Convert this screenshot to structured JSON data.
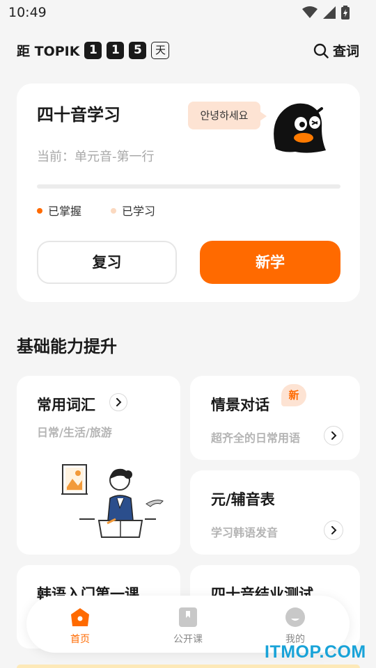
{
  "status_bar": {
    "time": "10:49"
  },
  "header": {
    "countdown_prefix": "距 TOPIK",
    "digits": [
      "1",
      "1",
      "5"
    ],
    "day_label": "天",
    "lookup_label": "查词"
  },
  "main_card": {
    "title": "四十音学习",
    "bubble_text": "안녕하세요",
    "current_label": "当前：单元音-第一行",
    "legend": {
      "mastered": "已掌握",
      "learned": "已学习"
    },
    "progress": {
      "mastered": 0,
      "learned": 0
    },
    "review_button": "复习",
    "new_button": "新学"
  },
  "section": {
    "title": "基础能力提升",
    "tiles": [
      {
        "title": "常用词汇",
        "subtitle": "日常/生活/旅游"
      },
      {
        "title": "情景对话",
        "subtitle": "超齐全的日常用语",
        "badge": "新"
      },
      {
        "title": "元/辅音表",
        "subtitle": "学习韩语发音"
      },
      {
        "title": "韩语入门第一课",
        "subtitle": ""
      },
      {
        "title": "四十音结业测试",
        "subtitle": ""
      }
    ]
  },
  "bottom_nav": {
    "items": [
      {
        "label": "首页",
        "active": true
      },
      {
        "label": "公开课",
        "active": false
      },
      {
        "label": "我的",
        "active": false
      }
    ]
  },
  "watermark": "ITMOP.COM",
  "colors": {
    "accent": "#ff6a00",
    "accent_light": "#fde3d3",
    "watermark": "#19a3d8"
  }
}
